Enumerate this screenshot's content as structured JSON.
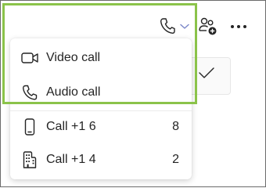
{
  "menu": {
    "items": [
      {
        "label": "Video call",
        "icon": "video-camera-icon"
      },
      {
        "label": "Audio call",
        "icon": "phone-icon"
      },
      {
        "label": "Call +1 6",
        "count": "8",
        "icon": "mobile-phone-icon"
      },
      {
        "label": "Call +1 4",
        "count": "2",
        "icon": "building-icon"
      }
    ]
  },
  "toolbar": {
    "icons": [
      "phone-icon",
      "chevron-down-icon",
      "add-people-icon",
      "more-options-icon"
    ]
  },
  "colors": {
    "highlight": "#8bc34a",
    "text": "#242424",
    "chevron": "#7a86c8"
  }
}
